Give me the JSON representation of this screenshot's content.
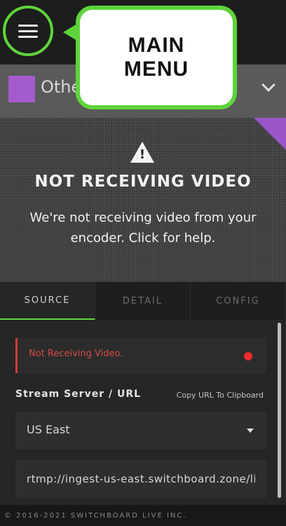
{
  "header": {
    "callout": "MAIN MENU"
  },
  "channel": {
    "name": "Othe",
    "color": "#a45ccc"
  },
  "video": {
    "title": "NOT RECEIVING VIDEO",
    "message": "We're not receiving video from your encoder. Click for help.",
    "icon": "warning-icon"
  },
  "tabs": [
    {
      "label": "SOURCE"
    },
    {
      "label": "DETAIL"
    },
    {
      "label": "CONFIG"
    }
  ],
  "source": {
    "alert": "Not Receiving Video.",
    "stream_label": "Stream Server / URL",
    "copy_label": "Copy URL To Clipboard",
    "server": "US East",
    "url": "rtmp://ingest-us-east.switchboard.zone/live"
  },
  "footer": {
    "copyright": "© 2016-2021 SWITCHBOARD LIVE INC."
  },
  "colors": {
    "accent": "#5ed43a",
    "error": "#d34a4a"
  }
}
